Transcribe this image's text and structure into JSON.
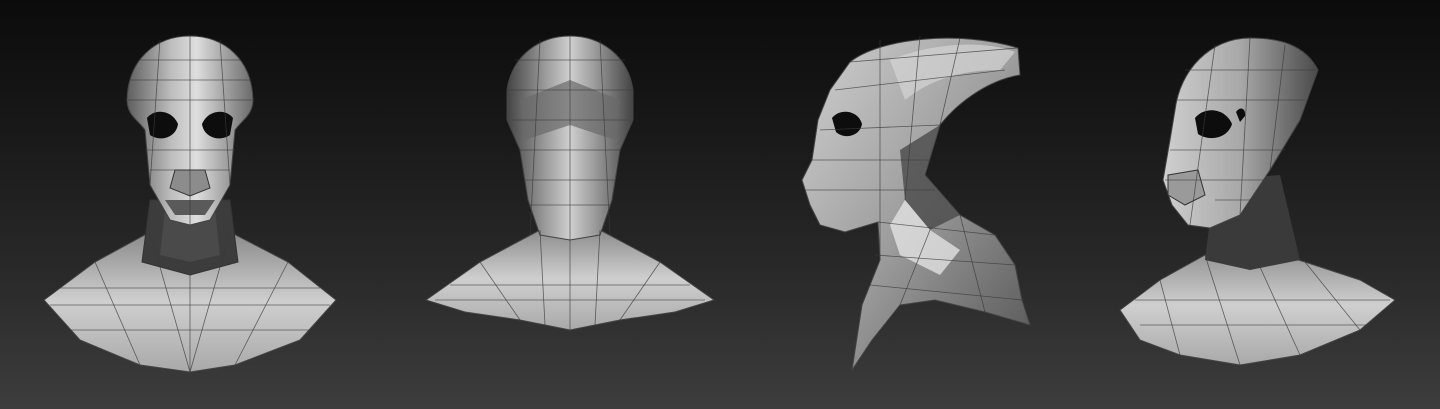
{
  "scene": {
    "background_top": "#0b0b0b",
    "background_bottom": "#3d3d3d",
    "mesh_color": "#b8b8b8",
    "views": [
      {
        "name": "front"
      },
      {
        "name": "back"
      },
      {
        "name": "side"
      },
      {
        "name": "three-quarter"
      }
    ]
  }
}
